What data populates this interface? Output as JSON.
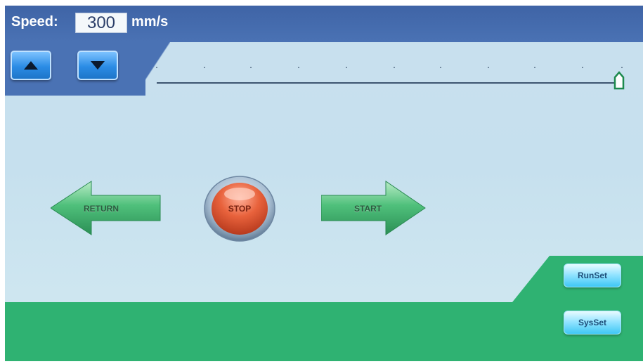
{
  "header": {
    "speed_label": "Speed:",
    "speed_value": "300",
    "speed_unit": "mm/s"
  },
  "controls": {
    "speed_up_icon": "triangle-up-icon",
    "speed_down_icon": "triangle-down-icon",
    "return_label": "RETURN",
    "stop_label": "STOP",
    "start_label": "START"
  },
  "side_buttons": {
    "runset_label": "RunSet",
    "sysset_label": "SysSet"
  },
  "slider": {
    "level_fraction": 1.0
  },
  "colors": {
    "header_blue": "#4a72b4",
    "background": "#c9e0ee",
    "green": "#2fb272",
    "stop_red": "#e0522e",
    "arrow_green": "#3aaa6a",
    "button_cyan": "#57d0f7"
  }
}
